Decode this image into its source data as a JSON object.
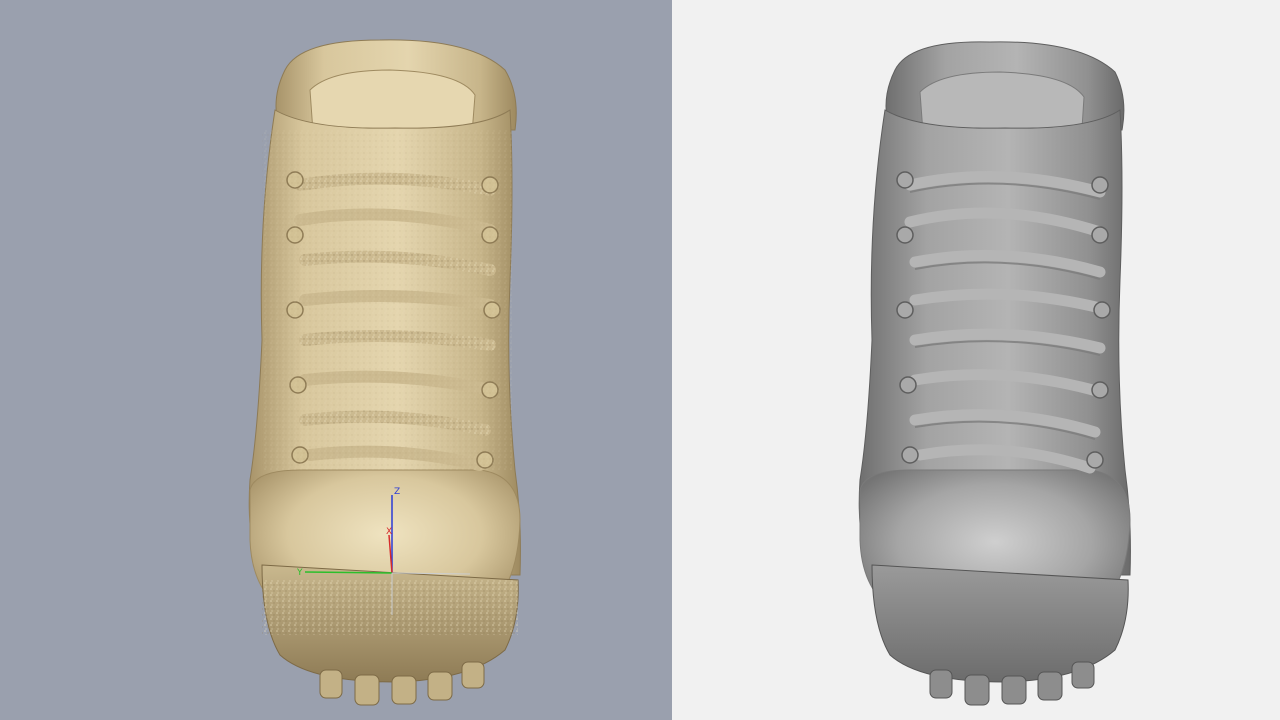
{
  "viewports": {
    "left": {
      "background": "#9aa0ae",
      "model_color": "#d9c9a0",
      "render_mode": "textured-scan"
    },
    "right": {
      "background": "#f1f1f1",
      "model_color": "#9c9c9c",
      "render_mode": "smooth-mesh"
    }
  },
  "axes": {
    "z_label": "Z",
    "x_label": "X",
    "y_label": "Y",
    "z_color": "#2b3bd6",
    "x_color": "#d62b2b",
    "y_color": "#2bbf2b"
  }
}
